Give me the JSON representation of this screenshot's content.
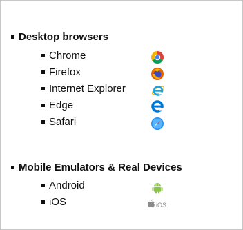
{
  "sections": [
    {
      "title": "Desktop browsers",
      "items": [
        {
          "label": "Chrome",
          "icon": "chrome-icon"
        },
        {
          "label": "Firefox",
          "icon": "firefox-icon"
        },
        {
          "label": "Internet Explorer",
          "icon": "internet-explorer-icon"
        },
        {
          "label": "Edge",
          "icon": "edge-icon"
        },
        {
          "label": "Safari",
          "icon": "safari-icon"
        }
      ]
    },
    {
      "title": "Mobile Emulators & Real Devices",
      "items": [
        {
          "label": "Android",
          "icon": "android-icon"
        },
        {
          "label": "iOS",
          "icon": "apple-ios-icon",
          "icon_text": "iOS"
        }
      ]
    }
  ],
  "colors": {
    "chrome_red": "#db4437",
    "chrome_yellow": "#f4b400",
    "chrome_green": "#0f9d58",
    "chrome_blue": "#4285f4",
    "firefox_orange": "#e66000",
    "ie_blue": "#1ba1e2",
    "edge_blue": "#0078d7",
    "safari_blue": "#1e90ff",
    "android_green": "#8bc34a",
    "apple_gray": "#8a8a8a"
  }
}
